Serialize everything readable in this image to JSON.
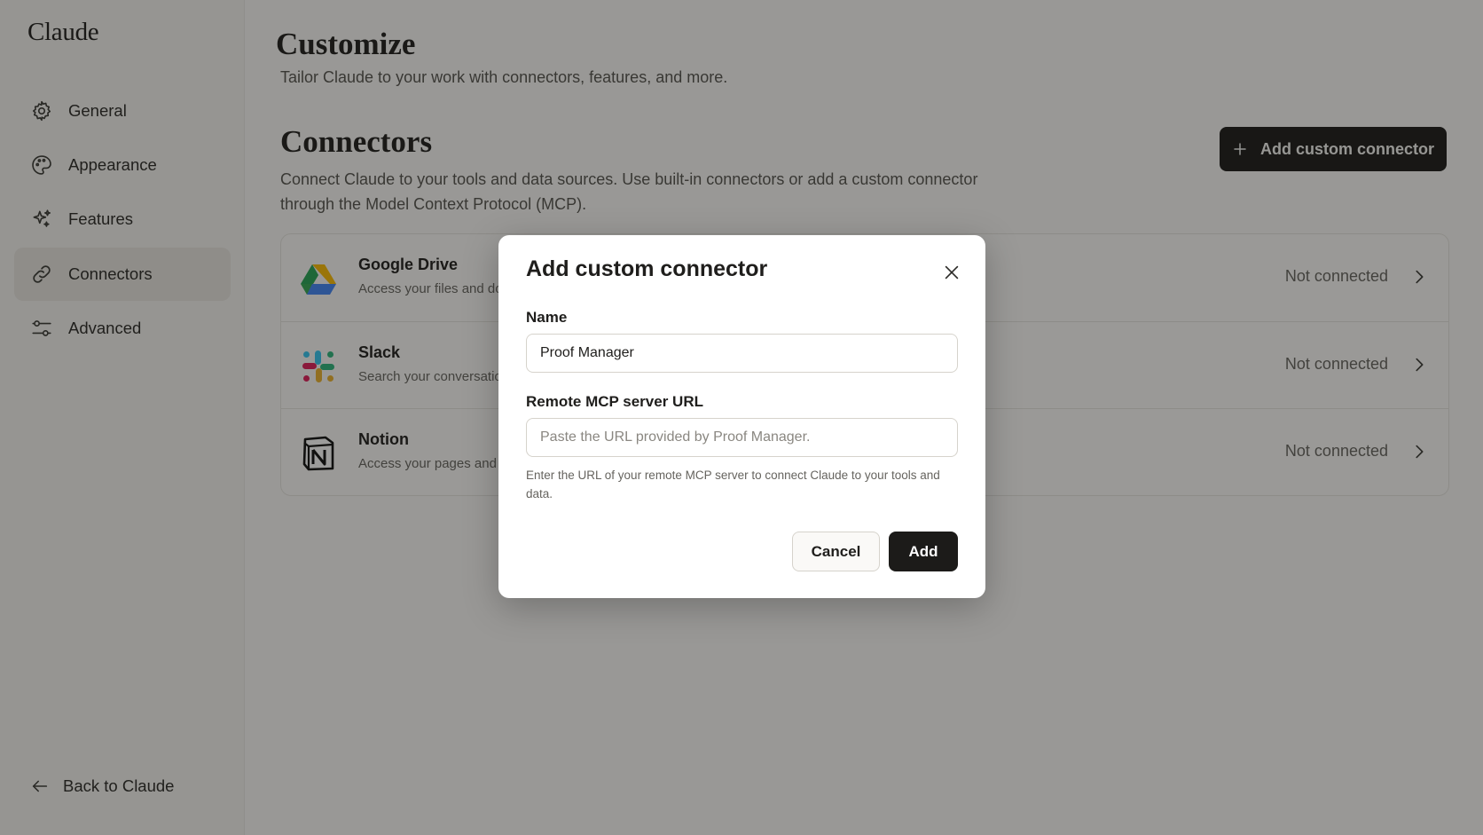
{
  "sidebar": {
    "brand": "Claude",
    "items": [
      {
        "label": "General",
        "icon": "gear-icon"
      },
      {
        "label": "Appearance",
        "icon": "palette-icon"
      },
      {
        "label": "Features",
        "icon": "sparkle-icon"
      },
      {
        "label": "Connectors",
        "icon": "link-icon",
        "active": true
      },
      {
        "label": "Advanced",
        "icon": "sliders-icon"
      }
    ],
    "back_label": "Back to Claude"
  },
  "main": {
    "title": "Customize",
    "subtitle": "Tailor Claude to your work with connectors, features, and more.",
    "section_title": "Connectors",
    "section_desc": "Connect Claude to your tools and data sources. Use built-in connectors or add a custom connector through the Model Context Protocol (MCP).",
    "add_button_label": "Add custom connector",
    "connectors": [
      {
        "name": "Google Drive",
        "desc": "Access your files and doc",
        "status": "Not connected",
        "icon": "google-drive-icon"
      },
      {
        "name": "Slack",
        "desc": "Search your conversation",
        "status": "Not connected",
        "icon": "slack-icon"
      },
      {
        "name": "Notion",
        "desc": "Access your pages and d",
        "status": "Not connected",
        "icon": "notion-icon"
      }
    ]
  },
  "modal": {
    "title": "Add custom connector",
    "name_label": "Name",
    "name_value": "Proof Manager",
    "url_label": "Remote MCP server URL",
    "url_placeholder": "Paste the URL provided by Proof Manager.",
    "helper_text": "Enter the URL of your remote MCP server to connect Claude to your tools and data.",
    "cancel_label": "Cancel",
    "add_label": "Add"
  },
  "colors": {
    "primary_button": "#1c1b19",
    "overlay": "#141311"
  }
}
